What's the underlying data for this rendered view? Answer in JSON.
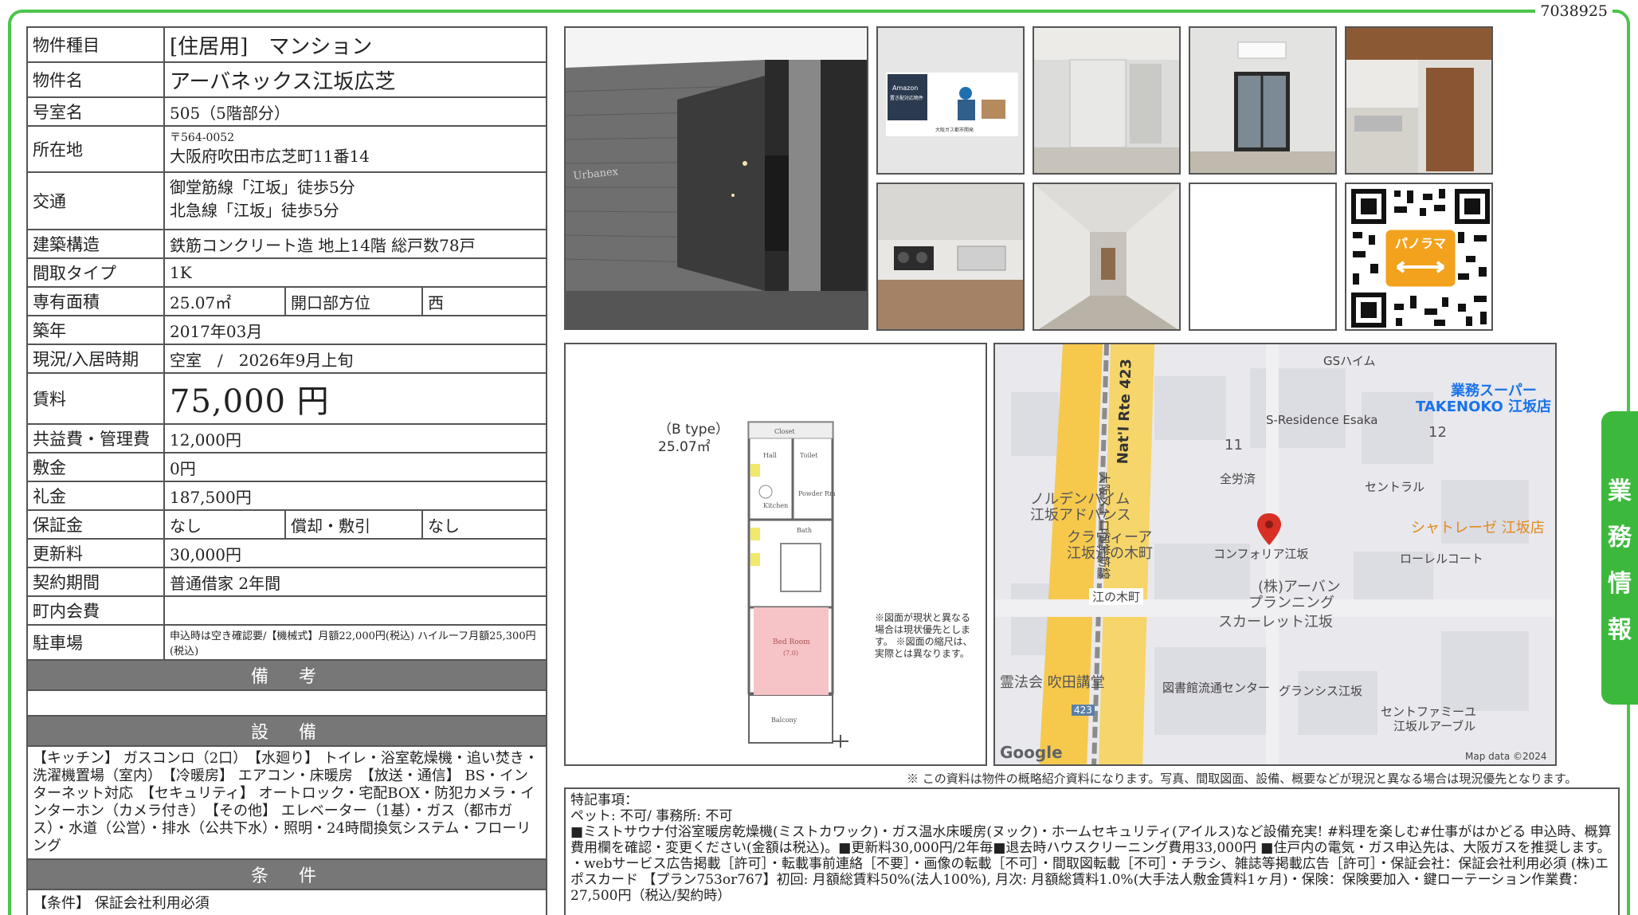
{
  "doc_number": "7038925",
  "table": {
    "type_label": "物件種目",
    "type_value": "[住居用]　マンション",
    "name_label": "物件名",
    "name_value": "アーバネックス江坂広芝",
    "room_label": "号室名",
    "room_value": "505（5階部分）",
    "address_label": "所在地",
    "zip": "〒564-0052",
    "address_value": "大阪府吹田市広芝町11番14",
    "transit_label": "交通",
    "transit_1": "御堂筋線「江坂」徒歩5分",
    "transit_2": "北急線「江坂」徒歩5分",
    "structure_label": "建築構造",
    "structure_value": "鉄筋コンクリート造  地上14階  総戸数78戸",
    "layout_label": "間取タイプ",
    "layout_value": "1K",
    "area_label": "専有面積",
    "area_value": "25.07㎡",
    "direction_label": "開口部方位",
    "direction_value": "西",
    "built_label": "築年",
    "built_value": "2017年03月",
    "status_label": "現況/入居時期",
    "status_value": "空室　/　2026年9月上旬",
    "rent_label": "賃料",
    "rent_value": "75,000 円",
    "common_label": "共益費・管理費",
    "common_value": "12,000円",
    "deposit_label": "敷金",
    "deposit_value": "0円",
    "key_label": "礼金",
    "key_value": "187,500円",
    "guarantee_label": "保証金",
    "guarantee_value": "なし",
    "amort_label": "償却・敷引",
    "amort_value": "なし",
    "renewal_label": "更新料",
    "renewal_value": "30,000円",
    "contract_label": "契約期間",
    "contract_value": "普通借家  2年間",
    "town_label": "町内会費",
    "town_value": "",
    "parking_label": "駐車場",
    "parking_value": "申込時は空き確認要/【機械式】月額22,000円(税込) ハイルーフ月額25,300円(税込)",
    "remarks_header": "備　考",
    "equipment_header": "設　備",
    "equipment_text": "【キッチン】 ガスコンロ（2口）　【水廻り】 トイレ・浴室乾燥機・追い焚き・洗濯機置場（室内）　【冷暖房】 エアコン・床暖房　【放送・通信】 BS・インターネット対応　【セキュリティ】 オートロック・宅配BOX・防犯カメラ・インターホン（カメラ付き）　【その他】 エレベーター（1基）・ガス（都市ガス）・水道（公営）・排水（公共下水）・照明・24時間換気システム・フローリング",
    "conditions_header": "条　件",
    "conditions_text": "【条件】 保証会社利用必須"
  },
  "photos": {
    "entrance_sign": "Urbanex",
    "amazon_title": "Amazon",
    "amazon_sub": "置き配対応物件",
    "amazon_footer": "大阪ガス都市開発",
    "panorama_label": "パノラマ"
  },
  "plan": {
    "type": "（B type）",
    "area": "25.07㎡",
    "note": "※図面が現状と異なる場合は現状優先とします。 ※図面の縮尺は、実際とは異なります。",
    "rooms": [
      "Closet",
      "Hall",
      "Toilet",
      "Kitchen",
      "Powder Rm",
      "Bath",
      "Bed Room",
      "Balcony"
    ],
    "bedroom_size": "(7.0)"
  },
  "map": {
    "labels": {
      "gs": "GSハイム",
      "takenoko1": "業務スーパー",
      "takenoko2": "TAKENOKO 江坂店",
      "sres": "S-Residence Esaka",
      "n11": "11",
      "n12": "12",
      "route": "Nat'l Rte 423",
      "metro": "大阪メトロ御堂筋線",
      "zen": "全労済",
      "central": "セントラル",
      "norden1": "ノルデンハイム",
      "norden2": "江坂アドバンス",
      "chateau": "シャトレーゼ 江坂店",
      "clavia1": "クラヴィーア",
      "clavia2": "江坂江の木町",
      "comfort": "コンフォリア江坂",
      "laurel": "ローレルコート",
      "urban1": "(株)アーバン",
      "urban2": "プランニング",
      "enoki": "江の木町",
      "scarlet": "スカーレット江坂",
      "reiho": "霊法会 吹田講堂",
      "library": "図書館流通センター",
      "grancis": "グランシス江坂",
      "route_no": "423",
      "centfa1": "セントファミーユ",
      "centfa2": "江坂ルアーブル",
      "google": "Google",
      "mapdata": "Map data ©2024"
    }
  },
  "disclaimer": "※ この資料は物件の概略紹介資料になります。写真、間取図面、設備、概要などが現況と異なる場合は現況優先となります。",
  "remarks": {
    "line1": "特記事項：",
    "line2": "ペット: 不可/ 事務所: 不可",
    "line3": "■ミストサウナ付浴室暖房乾燥機(ミストカワック)・ガス温水床暖房(ヌック)・ホームセキュリティ(アイルス)など設備充実! #料理を楽しむ#仕事がはかどる 申込時、概算費用欄を確認・変更ください(金額は税込)。■更新料30,000円/2年毎■退去時ハウスクリーニング費用33,000円 ■住戸内の電気・ガス申込先は、大阪ガスを推奨します。",
    "line4": "・webサービス広告掲載［許可］・転載事前連絡［不要］・画像の転載［不可］・間取図転載［不可］・チラシ、雑誌等掲載広告［許可］・保証会社：保証会社利用必須 (株)エポスカード 【プラン753or767】初回: 月額総賃料50%(法人100%), 月次: 月額総賃料1.0%(大手法人敷金賃料1ヶ月)・保険：保険要加入・鍵ローテーション作業費：27,500円（税込/契約時）"
  },
  "side_tab": [
    "業",
    "務",
    "情",
    "報"
  ],
  "colors": {
    "accent": "#3cb93c",
    "header_gray": "#777777",
    "pin": "#d93025"
  }
}
